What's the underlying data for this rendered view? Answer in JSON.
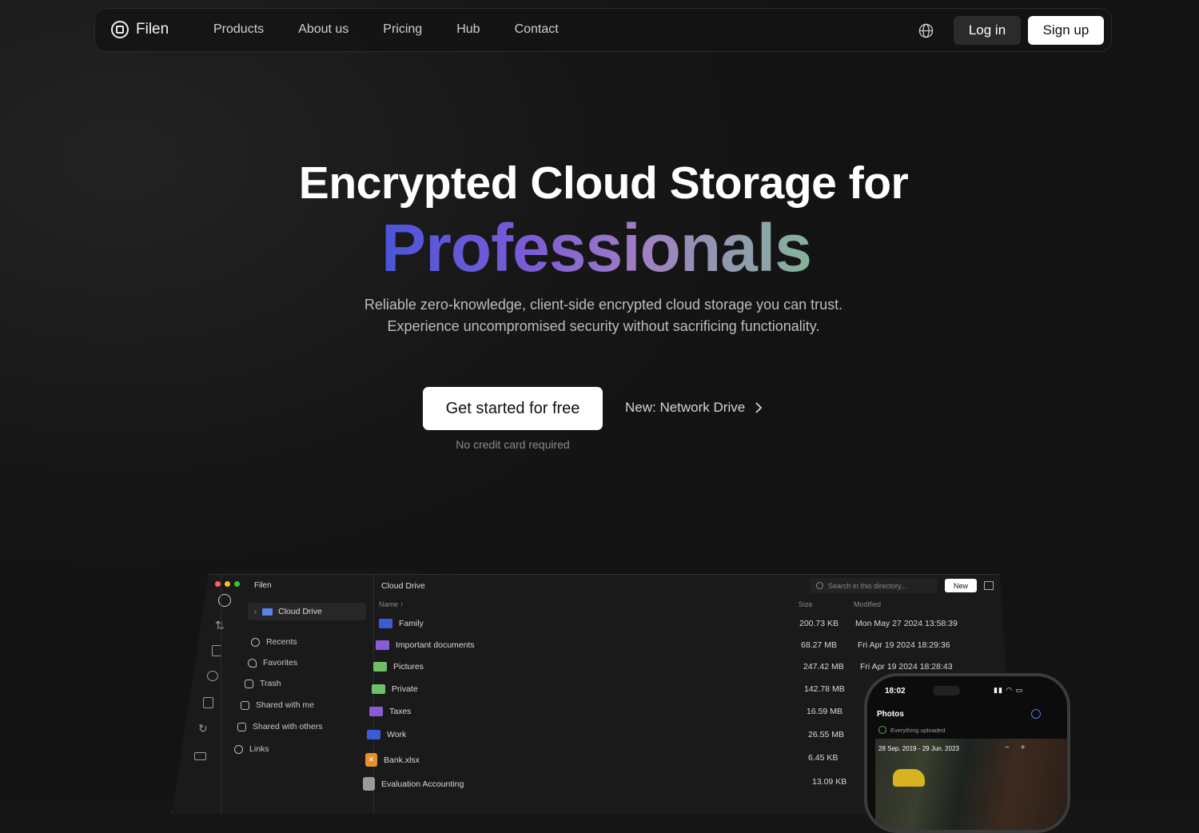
{
  "nav": {
    "brand": "Filen",
    "links": [
      "Products",
      "About us",
      "Pricing",
      "Hub",
      "Contact"
    ],
    "login_label": "Log in",
    "signup_label": "Sign up"
  },
  "hero": {
    "title_line1": "Encrypted Cloud Storage for",
    "title_line2": "Professionals",
    "subtitle_line1": "Reliable zero-knowledge, client-side encrypted cloud storage you can trust.",
    "subtitle_line2": "Experience uncompromised security without sacrificing functionality.",
    "cta_label": "Get started for free",
    "secondary_link": "New: Network Drive",
    "cta_note": "No credit card required"
  },
  "app": {
    "sidebar_title": "Filen",
    "drive_label": "Cloud Drive",
    "sidebar_items": [
      "Recents",
      "Favorites",
      "Trash",
      "Shared with me",
      "Shared with others",
      "Links"
    ],
    "main_title": "Cloud Drive",
    "search_placeholder": "Search in this directory...",
    "new_label": "New",
    "columns": {
      "name": "Name",
      "size": "Size",
      "modified": "Modified"
    },
    "rows": [
      {
        "name": "Family",
        "size": "200.73 KB",
        "modified": "Mon May 27 2024 13:58:39",
        "color": "#3d5bd6"
      },
      {
        "name": "Important documents",
        "size": "68.27 MB",
        "modified": "Fri Apr 19 2024 18:29:36",
        "color": "#8a5bd6"
      },
      {
        "name": "Pictures",
        "size": "247.42 MB",
        "modified": "Fri Apr 19 2024 18:28:43",
        "color": "#6fbf6a"
      },
      {
        "name": "Private",
        "size": "142.78 MB",
        "modified": "",
        "color": "#6fbf6a"
      },
      {
        "name": "Taxes",
        "size": "16.59 MB",
        "modified": "",
        "color": "#8a5bd6"
      },
      {
        "name": "Work",
        "size": "26.55 MB",
        "modified": "",
        "color": "#3d5bd6"
      },
      {
        "name": "Bank.xlsx",
        "size": "6.45 KB",
        "modified": "",
        "color": "#e8912b"
      },
      {
        "name": "Evaluation Accounting",
        "size": "13.09 KB",
        "modified": "",
        "color": "#9a9a9a"
      }
    ]
  },
  "phone": {
    "time": "18:02",
    "title": "Photos",
    "status": "Everything uploaded",
    "range": "28 Sep. 2019 - 29 Jun. 2023"
  }
}
